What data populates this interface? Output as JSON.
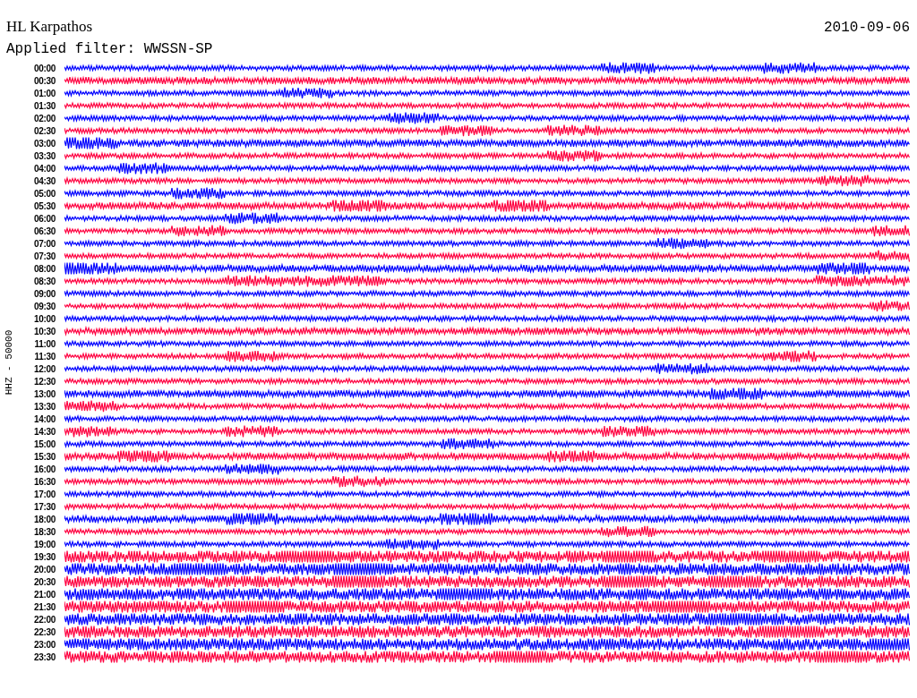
{
  "header": {
    "station": "HL Karpathos",
    "date": "2010-09-06",
    "filter": "Applied filter: WWSSN-SP"
  },
  "helicorder": {
    "ylabel": "HHZ - 50000",
    "rows": [
      {
        "time": "00:00",
        "color": "#0000ff"
      },
      {
        "time": "00:30",
        "color": "#ff0040"
      },
      {
        "time": "01:00",
        "color": "#0000ff"
      },
      {
        "time": "01:30",
        "color": "#ff0040"
      },
      {
        "time": "02:00",
        "color": "#0000ff"
      },
      {
        "time": "02:30",
        "color": "#ff0040"
      },
      {
        "time": "03:00",
        "color": "#0000ff"
      },
      {
        "time": "03:30",
        "color": "#ff0040"
      },
      {
        "time": "04:00",
        "color": "#0000ff"
      },
      {
        "time": "04:30",
        "color": "#ff0040"
      },
      {
        "time": "05:00",
        "color": "#0000ff"
      },
      {
        "time": "05:30",
        "color": "#ff0040"
      },
      {
        "time": "06:00",
        "color": "#0000ff"
      },
      {
        "time": "06:30",
        "color": "#ff0040"
      },
      {
        "time": "07:00",
        "color": "#0000ff"
      },
      {
        "time": "07:30",
        "color": "#ff0040"
      },
      {
        "time": "08:00",
        "color": "#0000ff"
      },
      {
        "time": "08:30",
        "color": "#ff0040"
      },
      {
        "time": "09:00",
        "color": "#0000ff"
      },
      {
        "time": "09:30",
        "color": "#ff0040"
      },
      {
        "time": "10:00",
        "color": "#0000ff"
      },
      {
        "time": "10:30",
        "color": "#ff0040"
      },
      {
        "time": "11:00",
        "color": "#0000ff"
      },
      {
        "time": "11:30",
        "color": "#ff0040"
      },
      {
        "time": "12:00",
        "color": "#0000ff"
      },
      {
        "time": "12:30",
        "color": "#ff0040"
      },
      {
        "time": "13:00",
        "color": "#0000ff"
      },
      {
        "time": "13:30",
        "color": "#ff0040"
      },
      {
        "time": "14:00",
        "color": "#0000ff"
      },
      {
        "time": "14:30",
        "color": "#ff0040"
      },
      {
        "time": "15:00",
        "color": "#0000ff"
      },
      {
        "time": "15:30",
        "color": "#ff0040"
      },
      {
        "time": "16:00",
        "color": "#0000ff"
      },
      {
        "time": "16:30",
        "color": "#ff0040"
      },
      {
        "time": "17:00",
        "color": "#0000ff"
      },
      {
        "time": "17:30",
        "color": "#ff0040"
      },
      {
        "time": "18:00",
        "color": "#0000ff"
      },
      {
        "time": "18:30",
        "color": "#ff0040"
      },
      {
        "time": "19:00",
        "color": "#0000ff"
      },
      {
        "time": "19:30",
        "color": "#ff0040"
      },
      {
        "time": "20:00",
        "color": "#0000ff"
      },
      {
        "time": "20:30",
        "color": "#ff0040"
      },
      {
        "time": "21:00",
        "color": "#0000ff"
      },
      {
        "time": "21:30",
        "color": "#ff0040"
      },
      {
        "time": "22:00",
        "color": "#0000ff"
      },
      {
        "time": "22:30",
        "color": "#ff0040"
      },
      {
        "time": "23:00",
        "color": "#0000ff"
      },
      {
        "time": "23:30",
        "color": "#ff0040"
      }
    ]
  }
}
